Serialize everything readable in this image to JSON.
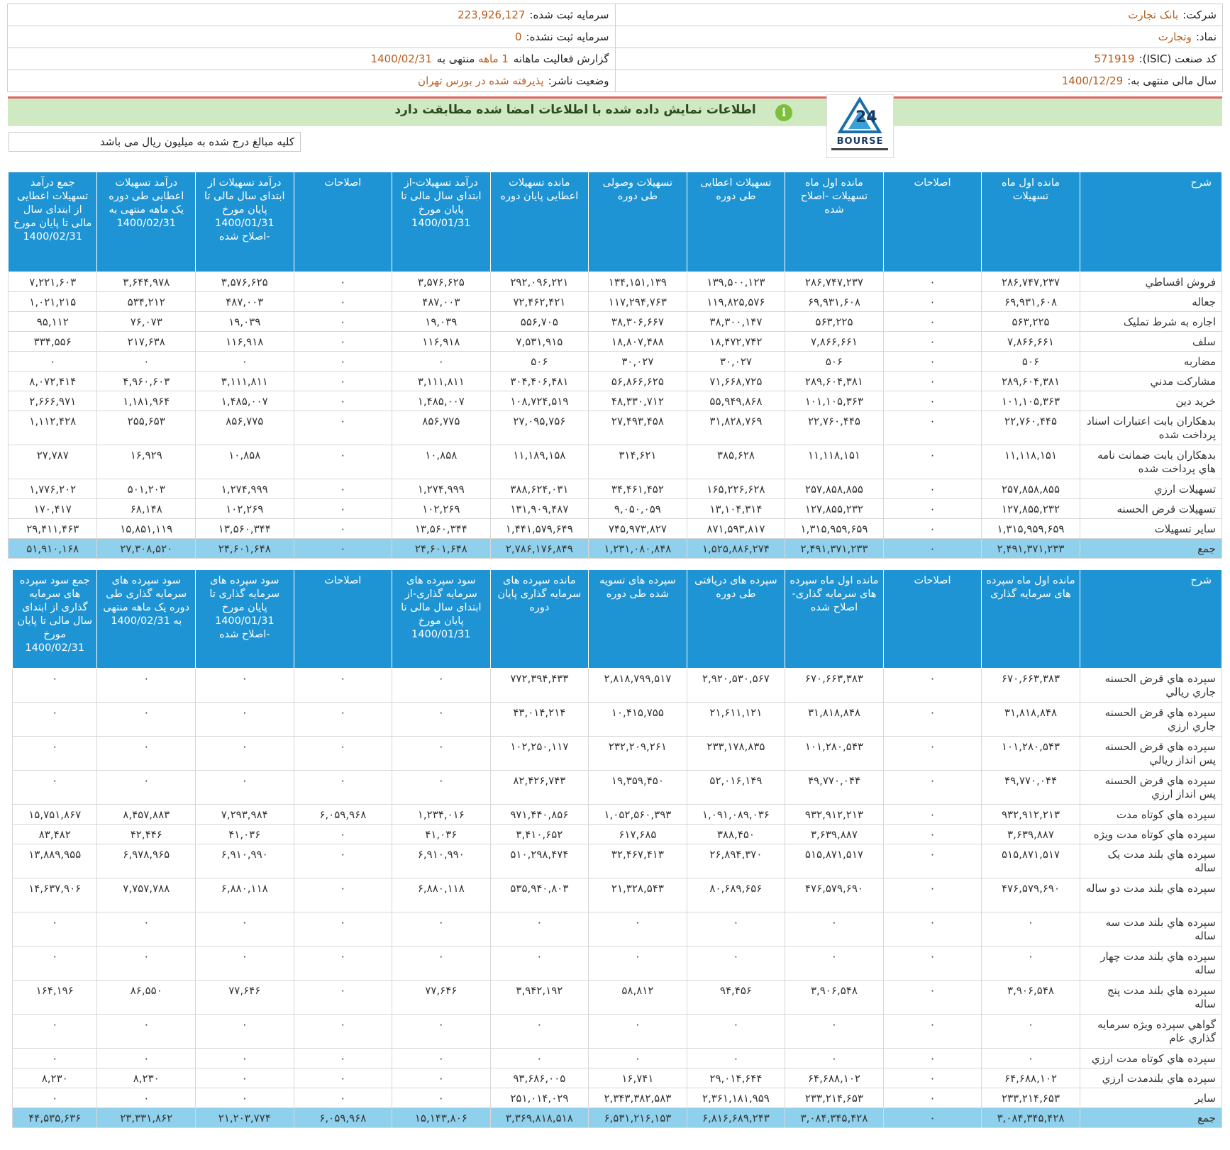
{
  "header": {
    "company_label": "شرکت:",
    "company": "بانک تجارت",
    "capital_label": "سرمایه ثبت شده:",
    "capital": "223,926,127",
    "symbol_label": "نماد:",
    "symbol": "وتجارت",
    "unreg_capital_label": "سرمایه ثبت نشده:",
    "unreg_capital": "0",
    "isic_label": "کد صنعت (ISIC):",
    "isic": "571919",
    "report_label": "گزارش فعالیت ماهانه",
    "report_months": "1 ماهه",
    "report_end_label": "منتهی به",
    "report_end": "1400/02/31",
    "fiscal_label": "سال مالی منتهی به:",
    "fiscal": "1400/12/29",
    "publisher_label": "وضعیت ناشر:",
    "publisher": "پذیرفته شده در بورس تهران"
  },
  "banner": {
    "text": "اطلاعات نمایش داده شده با اطلاعات امضا شده مطابقت دارد",
    "icon": "info-icon",
    "color": "#cfe9c2"
  },
  "logo": {
    "word": "BOURSE"
  },
  "units_note": "کلیه مبالغ درج شده به میلیون ریال می باشد",
  "table1": {
    "headers": [
      "شرح",
      "مانده اول ماه تسهیلات",
      "اصلاحات",
      "مانده اول ماه تسهیلات -اصلاح شده",
      "تسهیلات اعطایی طی دوره",
      "تسهیلات وصولی طی دوره",
      "مانده تسهیلات اعطایی پایان دوره",
      "درآمد تسهیلات-از ابتدای سال مالی تا پایان مورخ 1400/01/31",
      "اصلاحات",
      "درآمد تسهیلات از ابتدای سال مالی تا پایان مورخ 1400/01/31 -اصلاح شده",
      "درآمد تسهیلات اعطایی طی دوره یک ماهه منتهی به 1400/02/31",
      "جمع درآمد تسهیلات اعطایی از ابتدای سال مالی تا پایان مورخ 1400/02/31"
    ],
    "rows": [
      [
        "فروش اقساطي",
        "۲۸۶,۷۴۷,۲۳۷",
        "۰",
        "۲۸۶,۷۴۷,۲۳۷",
        "۱۳۹,۵۰۰,۱۲۳",
        "۱۳۴,۱۵۱,۱۳۹",
        "۲۹۲,۰۹۶,۲۲۱",
        "۳,۵۷۶,۶۲۵",
        "۰",
        "۳,۵۷۶,۶۲۵",
        "۳,۶۴۴,۹۷۸",
        "۷,۲۲۱,۶۰۳"
      ],
      [
        "جعاله",
        "۶۹,۹۳۱,۶۰۸",
        "۰",
        "۶۹,۹۳۱,۶۰۸",
        "۱۱۹,۸۲۵,۵۷۶",
        "۱۱۷,۲۹۴,۷۶۳",
        "۷۲,۴۶۲,۴۲۱",
        "۴۸۷,۰۰۳",
        "۰",
        "۴۸۷,۰۰۳",
        "۵۳۴,۲۱۲",
        "۱,۰۲۱,۲۱۵"
      ],
      [
        "اجاره به شرط تمليک",
        "۵۶۳,۲۲۵",
        "۰",
        "۵۶۳,۲۲۵",
        "۳۸,۳۰۰,۱۴۷",
        "۳۸,۳۰۶,۶۶۷",
        "۵۵۶,۷۰۵",
        "۱۹,۰۳۹",
        "۰",
        "۱۹,۰۳۹",
        "۷۶,۰۷۳",
        "۹۵,۱۱۲"
      ],
      [
        "سلف",
        "۷,۸۶۶,۶۶۱",
        "۰",
        "۷,۸۶۶,۶۶۱",
        "۱۸,۴۷۲,۷۴۲",
        "۱۸,۸۰۷,۴۸۸",
        "۷,۵۳۱,۹۱۵",
        "۱۱۶,۹۱۸",
        "۰",
        "۱۱۶,۹۱۸",
        "۲۱۷,۶۳۸",
        "۳۳۴,۵۵۶"
      ],
      [
        "مضاربه",
        "۵۰۶",
        "۰",
        "۵۰۶",
        "۳۰,۰۲۷",
        "۳۰,۰۲۷",
        "۵۰۶",
        "۰",
        "۰",
        "۰",
        "۰",
        "۰"
      ],
      [
        "مشارکت مدني",
        "۲۸۹,۶۰۴,۳۸۱",
        "۰",
        "۲۸۹,۶۰۴,۳۸۱",
        "۷۱,۶۶۸,۷۲۵",
        "۵۶,۸۶۶,۶۲۵",
        "۳۰۴,۴۰۶,۴۸۱",
        "۳,۱۱۱,۸۱۱",
        "۰",
        "۳,۱۱۱,۸۱۱",
        "۴,۹۶۰,۶۰۳",
        "۸,۰۷۲,۴۱۴"
      ],
      [
        "خريد دين",
        "۱۰۱,۱۰۵,۳۶۳",
        "۰",
        "۱۰۱,۱۰۵,۳۶۳",
        "۵۵,۹۴۹,۸۶۸",
        "۴۸,۳۳۰,۷۱۲",
        "۱۰۸,۷۲۴,۵۱۹",
        "۱,۴۸۵,۰۰۷",
        "۰",
        "۱,۴۸۵,۰۰۷",
        "۱,۱۸۱,۹۶۴",
        "۲,۶۶۶,۹۷۱"
      ],
      [
        "بدهکاران بابت اعتبارات اسناد پرداخت شده",
        "۲۲,۷۶۰,۴۴۵",
        "۰",
        "۲۲,۷۶۰,۴۴۵",
        "۳۱,۸۲۸,۷۶۹",
        "۲۷,۴۹۳,۴۵۸",
        "۲۷,۰۹۵,۷۵۶",
        "۸۵۶,۷۷۵",
        "۰",
        "۸۵۶,۷۷۵",
        "۲۵۵,۶۵۳",
        "۱,۱۱۲,۴۲۸"
      ],
      [
        "بدهکاران بابت ضمانت نامه هاي پرداخت شده",
        "۱۱,۱۱۸,۱۵۱",
        "۰",
        "۱۱,۱۱۸,۱۵۱",
        "۳۸۵,۶۲۸",
        "۳۱۴,۶۲۱",
        "۱۱,۱۸۹,۱۵۸",
        "۱۰,۸۵۸",
        "۰",
        "۱۰,۸۵۸",
        "۱۶,۹۲۹",
        "۲۷,۷۸۷"
      ],
      [
        "تسهيلات ارزي",
        "۲۵۷,۸۵۸,۸۵۵",
        "۰",
        "۲۵۷,۸۵۸,۸۵۵",
        "۱۶۵,۲۲۶,۶۲۸",
        "۳۴,۴۶۱,۴۵۲",
        "۳۸۸,۶۲۴,۰۳۱",
        "۱,۲۷۴,۹۹۹",
        "۰",
        "۱,۲۷۴,۹۹۹",
        "۵۰۱,۲۰۳",
        "۱,۷۷۶,۲۰۲"
      ],
      [
        "تسهيلات قرض الحسنه",
        "۱۲۷,۸۵۵,۲۳۲",
        "۰",
        "۱۲۷,۸۵۵,۲۳۲",
        "۱۳,۱۰۴,۳۱۴",
        "۹,۰۵۰,۰۵۹",
        "۱۳۱,۹۰۹,۴۸۷",
        "۱۰۲,۲۶۹",
        "۰",
        "۱۰۲,۲۶۹",
        "۶۸,۱۴۸",
        "۱۷۰,۴۱۷"
      ],
      [
        "ساير تسهيلات",
        "۱,۳۱۵,۹۵۹,۶۵۹",
        "۰",
        "۱,۳۱۵,۹۵۹,۶۵۹",
        "۸۷۱,۵۹۳,۸۱۷",
        "۷۴۵,۹۷۳,۸۲۷",
        "۱,۴۴۱,۵۷۹,۶۴۹",
        "۱۳,۵۶۰,۳۴۴",
        "۰",
        "۱۳,۵۶۰,۳۴۴",
        "۱۵,۸۵۱,۱۱۹",
        "۲۹,۴۱۱,۴۶۳"
      ]
    ],
    "total": [
      "جمع",
      "۲,۴۹۱,۳۷۱,۲۳۳",
      "۰",
      "۲,۴۹۱,۳۷۱,۲۳۳",
      "۱,۵۲۵,۸۸۶,۲۷۴",
      "۱,۲۳۱,۰۸۰,۸۴۸",
      "۲,۷۸۶,۱۷۶,۸۴۹",
      "۲۴,۶۰۱,۶۴۸",
      "۰",
      "۲۴,۶۰۱,۶۴۸",
      "۲۷,۳۰۸,۵۲۰",
      "۵۱,۹۱۰,۱۶۸"
    ]
  },
  "table2": {
    "headers": [
      "شرح",
      "مانده اول ماه سپرده های سرمایه گذاری",
      "اصلاحات",
      "مانده اول ماه سپرده های سرمایه گذاری-اصلاح شده",
      "سپرده های دریافتی طی دوره",
      "سپرده های تسویه شده طی دوره",
      "مانده سپرده های سرمایه گذاری پایان دوره",
      "سود سپرده های سرمایه گذاری-از ابتدای سال مالی تا پایان مورخ 1400/01/31",
      "اصلاحات",
      "سود سپرده های سرمایه گذاری تا پایان مورخ 1400/01/31 -اصلاح شده",
      "سود سپرده های سرمایه گذاری طی دوره یک ماهه منتهی به 1400/02/31",
      "جمع سود سپرده های سرمایه گذاری از ابتدای سال مالی تا پایان مورخ 1400/02/31"
    ],
    "rows": [
      [
        "سپرده هاي قرض الحسنه جاري ريالي",
        "۶۷۰,۶۶۳,۳۸۳",
        "۰",
        "۶۷۰,۶۶۳,۳۸۳",
        "۲,۹۲۰,۵۳۰,۵۶۷",
        "۲,۸۱۸,۷۹۹,۵۱۷",
        "۷۷۲,۳۹۴,۴۳۳",
        "۰",
        "۰",
        "۰",
        "۰",
        "۰"
      ],
      [
        "سپرده هاي قرض الحسنه جاري ارزي",
        "۳۱,۸۱۸,۸۴۸",
        "۰",
        "۳۱,۸۱۸,۸۴۸",
        "۲۱,۶۱۱,۱۲۱",
        "۱۰,۴۱۵,۷۵۵",
        "۴۳,۰۱۴,۲۱۴",
        "۰",
        "۰",
        "۰",
        "۰",
        "۰"
      ],
      [
        "سپرده هاي قرض الحسنه پس انداز ريالي",
        "۱۰۱,۲۸۰,۵۴۳",
        "۰",
        "۱۰۱,۲۸۰,۵۴۳",
        "۲۳۳,۱۷۸,۸۳۵",
        "۲۳۲,۲۰۹,۲۶۱",
        "۱۰۲,۲۵۰,۱۱۷",
        "۰",
        "۰",
        "۰",
        "۰",
        "۰"
      ],
      [
        "سپرده هاي قرض الحسنه پس انداز ارزي",
        "۴۹,۷۷۰,۰۴۴",
        "۰",
        "۴۹,۷۷۰,۰۴۴",
        "۵۲,۰۱۶,۱۴۹",
        "۱۹,۳۵۹,۴۵۰",
        "۸۲,۴۲۶,۷۴۳",
        "۰",
        "۰",
        "۰",
        "۰",
        "۰"
      ],
      [
        "سپرده هاي کوتاه مدت",
        "۹۳۲,۹۱۲,۲۱۳",
        "۰",
        "۹۳۲,۹۱۲,۲۱۳",
        "۱,۰۹۱,۰۸۹,۰۳۶",
        "۱,۰۵۲,۵۶۰,۳۹۳",
        "۹۷۱,۴۴۰,۸۵۶",
        "۱,۲۳۴,۰۱۶",
        "۶,۰۵۹,۹۶۸",
        "۷,۲۹۳,۹۸۴",
        "۸,۴۵۷,۸۸۳",
        "۱۵,۷۵۱,۸۶۷"
      ],
      [
        "سپرده هاي کوتاه مدت ويژه",
        "۳,۶۳۹,۸۸۷",
        "۰",
        "۳,۶۳۹,۸۸۷",
        "۳۸۸,۴۵۰",
        "۶۱۷,۶۸۵",
        "۳,۴۱۰,۶۵۲",
        "۴۱,۰۳۶",
        "۰",
        "۴۱,۰۳۶",
        "۴۲,۴۴۶",
        "۸۳,۴۸۲"
      ],
      [
        "سپرده هاي بلند مدت يک ساله",
        "۵۱۵,۸۷۱,۵۱۷",
        "۰",
        "۵۱۵,۸۷۱,۵۱۷",
        "۲۶,۸۹۴,۳۷۰",
        "۳۲,۴۶۷,۴۱۳",
        "۵۱۰,۲۹۸,۴۷۴",
        "۶,۹۱۰,۹۹۰",
        "۰",
        "۶,۹۱۰,۹۹۰",
        "۶,۹۷۸,۹۶۵",
        "۱۳,۸۸۹,۹۵۵"
      ],
      [
        "سپرده هاي بلند مدت دو ساله",
        "۴۷۶,۵۷۹,۶۹۰",
        "۰",
        "۴۷۶,۵۷۹,۶۹۰",
        "۸۰,۶۸۹,۶۵۶",
        "۲۱,۳۲۸,۵۴۳",
        "۵۳۵,۹۴۰,۸۰۳",
        "۶,۸۸۰,۱۱۸",
        "۰",
        "۶,۸۸۰,۱۱۸",
        "۷,۷۵۷,۷۸۸",
        "۱۴,۶۳۷,۹۰۶"
      ],
      [
        "سپرده هاي بلند مدت سه ساله",
        "۰",
        "۰",
        "۰",
        "۰",
        "۰",
        "۰",
        "۰",
        "۰",
        "۰",
        "۰",
        "۰"
      ],
      [
        "سپرده هاي بلند مدت چهار ساله",
        "۰",
        "۰",
        "۰",
        "۰",
        "۰",
        "۰",
        "۰",
        "۰",
        "۰",
        "۰",
        "۰"
      ],
      [
        "سپرده هاي بلند مدت پنج ساله",
        "۳,۹۰۶,۵۴۸",
        "۰",
        "۳,۹۰۶,۵۴۸",
        "۹۴,۴۵۶",
        "۵۸,۸۱۲",
        "۳,۹۴۲,۱۹۲",
        "۷۷,۶۴۶",
        "۰",
        "۷۷,۶۴۶",
        "۸۶,۵۵۰",
        "۱۶۴,۱۹۶"
      ],
      [
        "گواهي سپرده ويژه سرمايه گذاري عام",
        "۰",
        "۰",
        "۰",
        "۰",
        "۰",
        "۰",
        "۰",
        "۰",
        "۰",
        "۰",
        "۰"
      ],
      [
        "سپرده هاي کوتاه مدت ارزي",
        "۰",
        "۰",
        "۰",
        "۰",
        "۰",
        "۰",
        "۰",
        "۰",
        "۰",
        "۰",
        "۰"
      ],
      [
        "سپرده هاي بلندمدت ارزي",
        "۶۴,۶۸۸,۱۰۲",
        "۰",
        "۶۴,۶۸۸,۱۰۲",
        "۲۹,۰۱۴,۶۴۴",
        "۱۶,۷۴۱",
        "۹۳,۶۸۶,۰۰۵",
        "۰",
        "۰",
        "۰",
        "۸,۲۳۰",
        "۸,۲۳۰"
      ],
      [
        "ساير",
        "۲۳۳,۲۱۴,۶۵۳",
        "۰",
        "۲۳۳,۲۱۴,۶۵۳",
        "۲,۳۶۱,۱۸۱,۹۵۹",
        "۲,۳۴۳,۳۸۲,۵۸۳",
        "۲۵۱,۰۱۴,۰۲۹",
        "۰",
        "۰",
        "۰",
        "۰",
        "۰"
      ]
    ],
    "total": [
      "جمع",
      "۳,۰۸۴,۳۴۵,۴۲۸",
      "۰",
      "۳,۰۸۴,۳۴۵,۴۲۸",
      "۶,۸۱۶,۶۸۹,۲۴۳",
      "۶,۵۳۱,۲۱۶,۱۵۳",
      "۳,۳۶۹,۸۱۸,۵۱۸",
      "۱۵,۱۴۳,۸۰۶",
      "۶,۰۵۹,۹۶۸",
      "۲۱,۲۰۳,۷۷۴",
      "۲۳,۳۳۱,۸۶۲",
      "۴۴,۵۳۵,۶۳۶"
    ]
  }
}
